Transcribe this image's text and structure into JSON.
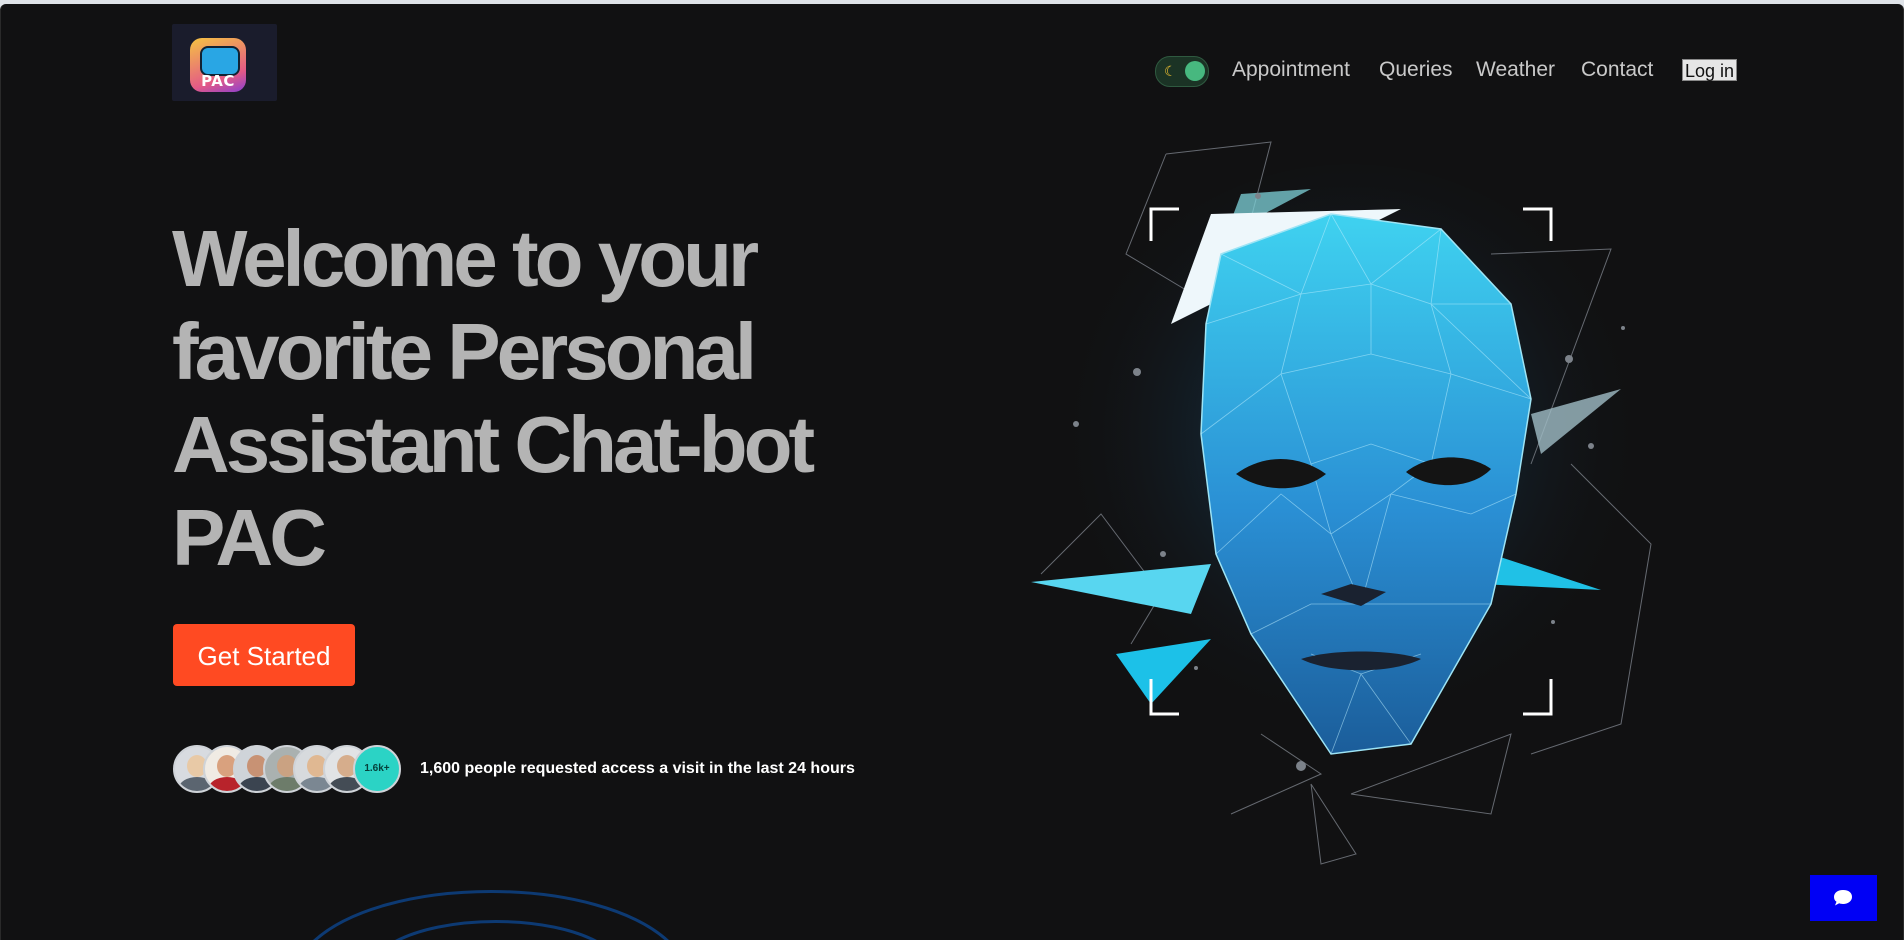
{
  "logo": {
    "text": "PAC"
  },
  "nav": {
    "theme_toggle_icon": "moon-icon",
    "links": [
      "Appointment",
      "Queries",
      "Weather",
      "Contact"
    ],
    "login_label": "Log in"
  },
  "hero": {
    "headline_lines": [
      "Welcome to your",
      "favorite Personal",
      "Assistant Chat-bot",
      "PAC"
    ],
    "cta_label": "Get Started",
    "avatar_count_badge": "1.6k+",
    "social_proof": "1,600 people requested access a visit in the last 24 hours"
  },
  "chat_widget": {
    "icon": "chat-bubble-icon"
  },
  "colors": {
    "background": "#111112",
    "cta": "#ff4a22",
    "chat_button": "#0000f5",
    "headline": "#b4b4b4",
    "accent_face": "#2aa7e6"
  }
}
